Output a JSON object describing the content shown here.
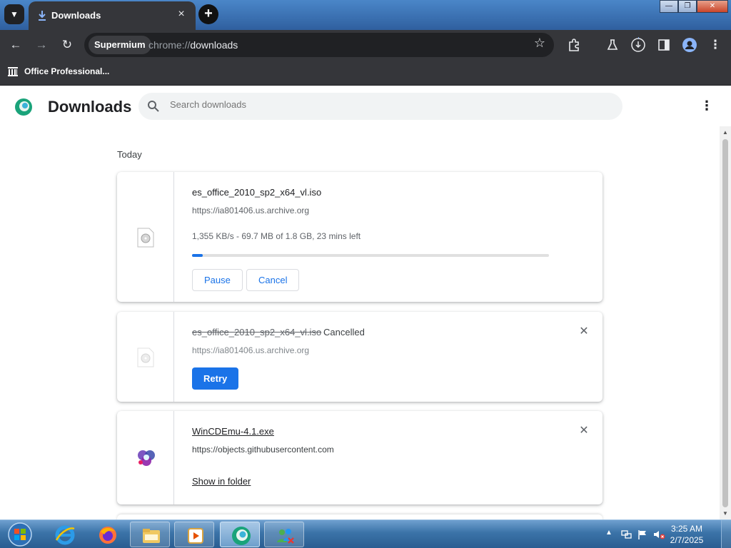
{
  "window": {
    "tab_title": "Downloads",
    "new_tab_label": "+",
    "tab_close_label": "×",
    "min_label": "—",
    "max_label": "❐",
    "close_label": "✕"
  },
  "toolbar": {
    "profile_chip": "Supermium",
    "url_scheme": "chrome://",
    "url_host": "downloads"
  },
  "bookmarks": [
    {
      "label": "Office Professional...",
      "icon": "archive-icon"
    }
  ],
  "page": {
    "title": "Downloads",
    "search_placeholder": "Search downloads",
    "section_label": "Today"
  },
  "downloads": [
    {
      "filename": "es_office_2010_sp2_x64_vl.iso",
      "source": "https://ia801406.us.archive.org",
      "status": "1,355 KB/s - 69.7 MB of 1.8 GB, 23 mins left",
      "progress": 0.03,
      "actions": [
        "Pause",
        "Cancel"
      ],
      "state": "in_progress"
    },
    {
      "filename": "es_office_2010_sp2_x64_vl.iso",
      "source": "https://ia801406.us.archive.org",
      "status": "Cancelled",
      "actions": [
        "Retry"
      ],
      "state": "cancelled"
    },
    {
      "filename": "WinCDEmu-4.1.exe",
      "source": "https://objects.githubusercontent.com",
      "actions": [
        "Show in folder"
      ],
      "state": "complete"
    }
  ],
  "taskbar": {
    "apps": [
      "internet-explorer-icon",
      "firefox-icon",
      "file-explorer-icon",
      "media-player-icon",
      "supermium-icon",
      "network-users-icon"
    ],
    "time": "3:25 AM",
    "date": "2/7/2025"
  },
  "colors": {
    "accent": "#1a73e8",
    "chrome_dark": "#35363a",
    "omnibox": "#202124"
  }
}
